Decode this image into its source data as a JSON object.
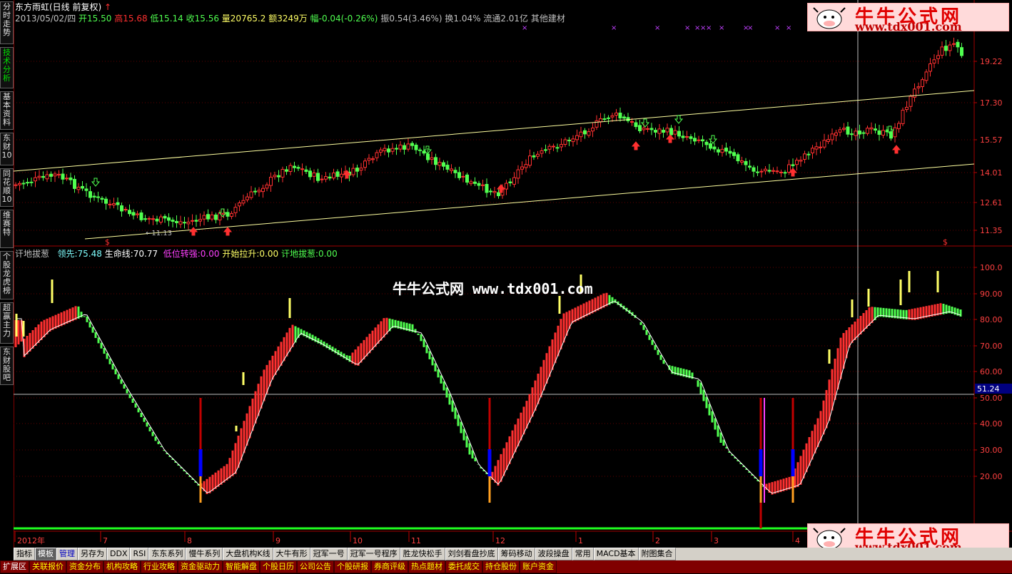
{
  "sidebar": {
    "tabs": [
      {
        "label": "分时走势"
      },
      {
        "label": "技术分析"
      },
      {
        "label": "基本资料"
      },
      {
        "label": "东财10"
      },
      {
        "label": "同花顺10"
      },
      {
        "label": "维赛特"
      },
      {
        "label": "个股龙虎榜"
      },
      {
        "label": "超赢主力"
      },
      {
        "label": "东财股吧"
      }
    ]
  },
  "header": {
    "stock_name": "东方雨虹(日线 前复权)",
    "date": "2013/05/02/四",
    "open": "开15.50",
    "high": "高15.68",
    "low": "低15.14",
    "close": "收15.56",
    "volume": "量20765.2",
    "amount": "额3249万",
    "change": "幅-0.04(-0.26%)",
    "amplitude": "振0.54(3.46%)",
    "turnover": "换1.04%",
    "float": "流通2.01亿",
    "industry": "其他建材"
  },
  "price_axis": [
    "19.22",
    "17.30",
    "15.57",
    "14.01",
    "12.61",
    "11.35"
  ],
  "low_marker": "11.13",
  "indicator": {
    "name": "讦地拔葱",
    "lead_label": "领先:",
    "lead_value": "75.48",
    "life_label": "生命线:",
    "life_value": "70.77",
    "low_label": "低位转强:",
    "low_value": "0.00",
    "pull_label": "开始拉升:",
    "pull_value": "0.00",
    "dig_label": "讦地拔葱:",
    "dig_value": "0.00",
    "axis": [
      "100.0",
      "90.00",
      "80.00",
      "70.00",
      "60.00",
      "50.00",
      "40.00",
      "30.00",
      "20.00"
    ],
    "cursor_value": "51.24"
  },
  "time_axis": [
    "2012年",
    "7",
    "8",
    "9",
    "10",
    "11",
    "12",
    "1",
    "2",
    "3",
    "4"
  ],
  "toolbar_top": [
    {
      "label": "指标"
    },
    {
      "label": "模板"
    },
    {
      "label": "管理"
    },
    {
      "label": "另存为"
    },
    {
      "label": "DDX"
    },
    {
      "label": "RSI"
    },
    {
      "label": "东东系列"
    },
    {
      "label": "慢牛系列"
    },
    {
      "label": "大盘机构K线"
    },
    {
      "label": "大牛有形"
    },
    {
      "label": "冠军一号"
    },
    {
      "label": "冠军一号程序"
    },
    {
      "label": "胜龙快松手"
    },
    {
      "label": "刘剑看盘抄底"
    },
    {
      "label": "筹码移动"
    },
    {
      "label": "波段操盘"
    },
    {
      "label": "常用"
    },
    {
      "label": "MACD基本"
    },
    {
      "label": "附图集合"
    }
  ],
  "toolbar_bottom": [
    {
      "label": "扩展区"
    },
    {
      "label": "关联报价"
    },
    {
      "label": "资金分布"
    },
    {
      "label": "机构攻略"
    },
    {
      "label": "行业攻略"
    },
    {
      "label": "资金驱动力"
    },
    {
      "label": "智能解盘"
    },
    {
      "label": "个股日历"
    },
    {
      "label": "公司公告"
    },
    {
      "label": "个股研报"
    },
    {
      "label": "券商评级"
    },
    {
      "label": "热点题材"
    },
    {
      "label": "委托成交"
    },
    {
      "label": "持仓股份"
    },
    {
      "label": "账户资金"
    }
  ],
  "watermark": {
    "cn": "牛牛公式网",
    "url": "www.tdx001.com"
  },
  "center_watermark": "牛牛公式网 www.tdx001.com",
  "chart_data": {
    "type": "candlestick",
    "y_range": [
      10.9,
      20.6
    ],
    "indicator_range": [
      8,
      103
    ],
    "note_levels": {
      "cursor": 51.24
    }
  },
  "colors": {
    "up": "#ff3030",
    "down": "#50ff50",
    "axis": "#c00000",
    "yellow": "#ffff66"
  }
}
